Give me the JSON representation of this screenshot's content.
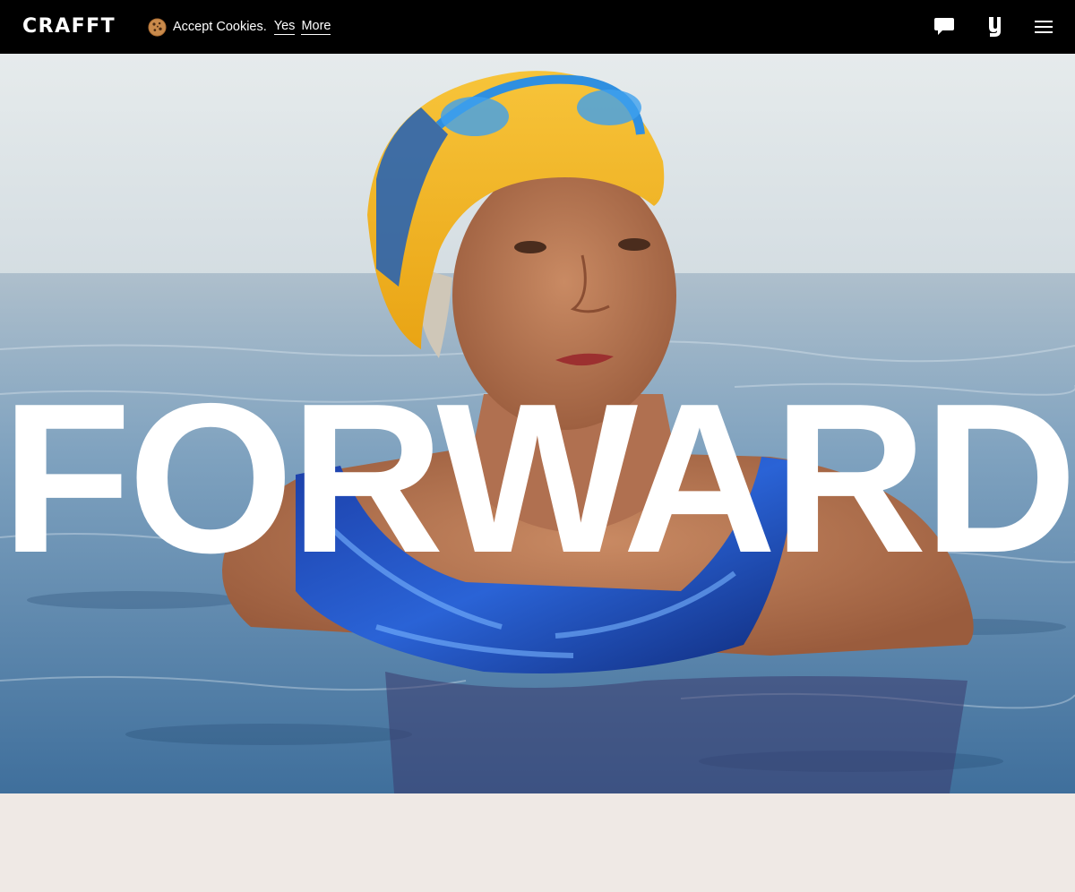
{
  "header": {
    "logo": "CRAFFT",
    "cookie_banner": {
      "icon": "cookie-icon",
      "text": "Accept Cookies.",
      "yes_label": "Yes",
      "more_label": "More"
    },
    "icons": [
      "chat-icon",
      "brand-g-icon",
      "hamburger-menu-icon"
    ]
  },
  "hero": {
    "headline": "FORWARD",
    "image": "swimmer-portrait-image"
  },
  "colors": {
    "topbar": "#000000",
    "hero_text": "#ffffff",
    "page_background": "#efe9e5",
    "cap_yellow": "#f5b524",
    "water_blue": "#5c8fb8"
  }
}
